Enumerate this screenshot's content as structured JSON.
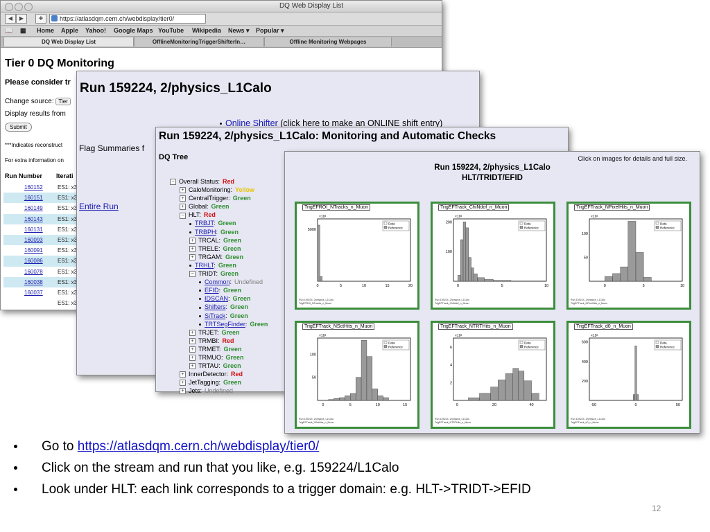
{
  "browser": {
    "title": "DQ Web Display List",
    "url": "https://atlasdqm.cern.ch/webdisplay/tier0/",
    "bookmarks": [
      "Home",
      "Apple",
      "Yahoo!",
      "Google Maps",
      "YouTube",
      "Wikipedia",
      "News ▾",
      "Popular ▾"
    ],
    "tabs": [
      "DQ Web Display List",
      "OfflineMonitoringTriggerShifterIn…",
      "Offline Monitoring Webpages"
    ]
  },
  "tier0": {
    "title": "Tier 0 DQ Monitoring",
    "consider": "Please consider tr",
    "change_source": "Change source:",
    "source_value": "Tier",
    "display_results": "Display results from",
    "submit": "Submit",
    "note_reconstruct": "***Indicates reconstruct",
    "note_extra": "For extra information on",
    "col_run": "Run Number",
    "col_iter": "Iterati",
    "runs": [
      {
        "run": "160152",
        "es": "ES1: x3",
        "hl": false
      },
      {
        "run": "160151",
        "es": "ES1: x3",
        "hl": true
      },
      {
        "run": "160149",
        "es": "ES1: x3",
        "hl": false
      },
      {
        "run": "160143",
        "es": "ES1: x3",
        "hl": true
      },
      {
        "run": "160131",
        "es": "ES1: x3",
        "hl": false
      },
      {
        "run": "160093",
        "es": "ES1: x3",
        "hl": true
      },
      {
        "run": "160091",
        "es": "ES1: x3",
        "hl": false
      },
      {
        "run": "160086",
        "es": "ES1: x3",
        "hl": true
      },
      {
        "run": "160078",
        "es": "ES1: x3",
        "hl": false
      },
      {
        "run": "160038",
        "es": "ES1: x3",
        "hl": true
      },
      {
        "run": "160037",
        "es": "ES1: x3",
        "hl": false
      },
      {
        "run": "",
        "es": "ES1: x3",
        "hl": false
      }
    ]
  },
  "run_page": {
    "title": "Run 159224, 2/physics_L1Calo",
    "online_link": "Online Shifter",
    "online_rest": " (click here to make an ONLINE shift entry)",
    "flag_summaries": "Flag Summaries f",
    "entire_run": "Entire Run"
  },
  "checks_page": {
    "title": "Run 159224, 2/physics_L1Calo: Monitoring and Automatic Checks",
    "tree_title": "DQ Tree",
    "tree": [
      {
        "indent": 0,
        "marker": "minus",
        "name": "Overall Status:",
        "link": false,
        "status": "Red"
      },
      {
        "indent": 1,
        "marker": "plus",
        "name": "CaloMonitoring:",
        "link": false,
        "status": "Yellow"
      },
      {
        "indent": 1,
        "marker": "plus",
        "name": "CentralTrigger:",
        "link": false,
        "status": "Green"
      },
      {
        "indent": 1,
        "marker": "plus",
        "name": "Global:",
        "link": false,
        "status": "Green"
      },
      {
        "indent": 1,
        "marker": "minus",
        "name": "HLT:",
        "link": false,
        "status": "Red"
      },
      {
        "indent": 2,
        "marker": "dot",
        "name": "TRBJT",
        "link": true,
        "status": "Green"
      },
      {
        "indent": 2,
        "marker": "dot",
        "name": "TRBPH",
        "link": true,
        "status": "Green"
      },
      {
        "indent": 2,
        "marker": "plus",
        "name": "TRCAL:",
        "link": false,
        "status": "Green"
      },
      {
        "indent": 2,
        "marker": "plus",
        "name": "TRELE:",
        "link": false,
        "status": "Green"
      },
      {
        "indent": 2,
        "marker": "plus",
        "name": "TRGAM:",
        "link": false,
        "status": "Green"
      },
      {
        "indent": 2,
        "marker": "dot",
        "name": "TRHLT",
        "link": true,
        "status": "Green"
      },
      {
        "indent": 2,
        "marker": "minus",
        "name": "TRIDT:",
        "link": false,
        "status": "Green"
      },
      {
        "indent": 3,
        "marker": "dot",
        "name": "Common",
        "link": true,
        "status": "Undefined"
      },
      {
        "indent": 3,
        "marker": "dot",
        "name": "EFID",
        "link": true,
        "status": "Green"
      },
      {
        "indent": 3,
        "marker": "dot",
        "name": "IDSCAN",
        "link": true,
        "status": "Green"
      },
      {
        "indent": 3,
        "marker": "dot",
        "name": "Shifters",
        "link": true,
        "status": "Green"
      },
      {
        "indent": 3,
        "marker": "dot",
        "name": "SiTrack",
        "link": true,
        "status": "Green"
      },
      {
        "indent": 3,
        "marker": "dot",
        "name": "TRTSegFinder",
        "link": true,
        "status": "Green"
      },
      {
        "indent": 2,
        "marker": "plus",
        "name": "TRJET:",
        "link": false,
        "status": "Green"
      },
      {
        "indent": 2,
        "marker": "plus",
        "name": "TRMBI:",
        "link": false,
        "status": "Red"
      },
      {
        "indent": 2,
        "marker": "plus",
        "name": "TRMET:",
        "link": false,
        "status": "Green"
      },
      {
        "indent": 2,
        "marker": "plus",
        "name": "TRMUO:",
        "link": false,
        "status": "Green"
      },
      {
        "indent": 2,
        "marker": "plus",
        "name": "TRTAU:",
        "link": false,
        "status": "Green"
      },
      {
        "indent": 1,
        "marker": "plus",
        "name": "InnerDetector:",
        "link": false,
        "status": "Red"
      },
      {
        "indent": 1,
        "marker": "plus",
        "name": "JetTagging:",
        "link": false,
        "status": "Green"
      },
      {
        "indent": 1,
        "marker": "plus",
        "name": "Jets:",
        "link": false,
        "status": "Undefined"
      }
    ]
  },
  "histo_page": {
    "click_note": "Click on images for details and full size.",
    "title1": "Run 159224, 2/physics_L1Calo",
    "title2": "HLT/TRIDT/EFID",
    "legend_data": "Data",
    "legend_ref": "Reference",
    "plots": [
      {
        "name": "TrigEFROI_NTracks_n_Muon",
        "xticks": [
          "0",
          "5",
          "10",
          "15",
          "20"
        ],
        "yticks": [
          "5000"
        ],
        "exp": "×10³",
        "xrange": [
          0,
          20
        ],
        "ymax": 6000,
        "bins": [
          [
            0,
            0.5,
            5400
          ],
          [
            0.5,
            1,
            450
          ]
        ]
      },
      {
        "name": "TrigEFTrack_ChiNdof_n_Muon",
        "xticks": [
          "0",
          "5",
          "10"
        ],
        "yticks": [
          "100",
          "200"
        ],
        "exp": "×10³",
        "xrange": [
          -0.5,
          10
        ],
        "ymax": 210,
        "bins": [
          [
            0,
            0.3,
            20
          ],
          [
            0.3,
            0.6,
            140
          ],
          [
            0.6,
            0.9,
            200
          ],
          [
            0.9,
            1.2,
            180
          ],
          [
            1.2,
            1.5,
            80
          ],
          [
            1.5,
            1.8,
            45
          ],
          [
            1.8,
            2.2,
            25
          ],
          [
            2.2,
            3,
            12
          ],
          [
            3,
            4,
            6
          ],
          [
            4,
            6,
            3
          ],
          [
            6,
            10,
            1
          ]
        ]
      },
      {
        "name": "TrigEFTrack_NPixelHits_n_Muon",
        "xticks": [
          "0",
          "5",
          "10"
        ],
        "yticks": [
          "50",
          "100"
        ],
        "exp": "×10³",
        "xrange": [
          -2,
          10
        ],
        "ymax": 130,
        "bins": [
          [
            0,
            1,
            10
          ],
          [
            1,
            2,
            16
          ],
          [
            2,
            3,
            30
          ],
          [
            3,
            4,
            125
          ],
          [
            4,
            5,
            60
          ],
          [
            5,
            6,
            8
          ]
        ]
      },
      {
        "name": "TrigEFTrack_NSctHits_n_Muon",
        "xticks": [
          "0",
          "5",
          "10",
          "15"
        ],
        "yticks": [
          "50",
          "100"
        ],
        "exp": "×10³",
        "xrange": [
          -1,
          16
        ],
        "ymax": 135,
        "bins": [
          [
            1,
            2,
            2
          ],
          [
            2,
            3,
            4
          ],
          [
            3,
            4,
            6
          ],
          [
            4,
            5,
            10
          ],
          [
            5,
            6,
            15
          ],
          [
            6,
            7,
            50
          ],
          [
            7,
            8,
            130
          ],
          [
            8,
            9,
            95
          ],
          [
            9,
            10,
            25
          ],
          [
            10,
            11,
            10
          ],
          [
            11,
            12,
            6
          ]
        ]
      },
      {
        "name": "TrigEFTrack_NTRTHits_n_Muon",
        "xticks": [
          "0",
          "20",
          "40"
        ],
        "yticks": [
          "2",
          "4",
          "6"
        ],
        "exp": "×10³",
        "xrange": [
          -2,
          48
        ],
        "ymax": 7,
        "bins": [
          [
            6,
            12,
            0.3
          ],
          [
            12,
            18,
            0.8
          ],
          [
            18,
            22,
            1.5
          ],
          [
            22,
            26,
            2.3
          ],
          [
            26,
            30,
            3.0
          ],
          [
            30,
            33,
            3.6
          ],
          [
            33,
            36,
            3.3
          ],
          [
            36,
            40,
            2.2
          ],
          [
            40,
            44,
            0.8
          ]
        ]
      },
      {
        "name": "TrigEFTrack_d0_n_Muon",
        "xticks": [
          "-50",
          "0",
          "50"
        ],
        "yticks": [
          "200",
          "400",
          "600"
        ],
        "exp": "×10³",
        "xrange": [
          -55,
          55
        ],
        "ymax": 640,
        "bins": [
          [
            -3,
            -1,
            60
          ],
          [
            -1,
            1,
            560
          ],
          [
            1,
            3,
            60
          ]
        ]
      }
    ]
  },
  "slide": {
    "bullet1_prefix": "Go to ",
    "bullet1_link": "https://atlasdqm.cern.ch/webdisplay/tier0/",
    "bullet2": "Click on the stream and run that you like, e.g. 159224/L1Calo",
    "bullet3": "Look under HLT: each link corresponds to a trigger domain: e.g. HLT->TRIDT->EFID",
    "page_number": "12"
  },
  "colors": {
    "status_green": "#2f8f2f",
    "status_red": "#d01010",
    "status_yellow": "#e8c400",
    "hist_frame": "#3b8e3b",
    "hist_fill": "#9a9a9a"
  }
}
